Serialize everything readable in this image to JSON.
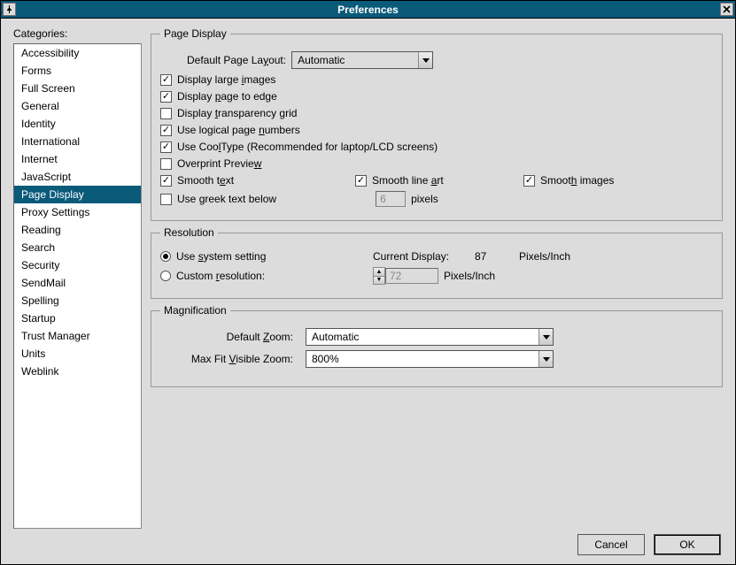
{
  "title": "Preferences",
  "categories_label": "Categories:",
  "categories": [
    "Accessibility",
    "Forms",
    "Full Screen",
    "General",
    "Identity",
    "International",
    "Internet",
    "JavaScript",
    "Page Display",
    "Proxy Settings",
    "Reading",
    "Search",
    "Security",
    "SendMail",
    "Spelling",
    "Startup",
    "Trust Manager",
    "Units",
    "Weblink"
  ],
  "selected_category_index": 8,
  "page_display": {
    "legend": "Page Display",
    "default_layout_label_pre": "Default Page La",
    "default_layout_label_u": "y",
    "default_layout_label_post": "out:",
    "default_layout_value": "Automatic",
    "cb_large_images": {
      "checked": true,
      "pre": "Display large ",
      "u": "i",
      "post": "mages"
    },
    "cb_page_edge": {
      "checked": true,
      "pre": "Display ",
      "u": "p",
      "post": "age to edge"
    },
    "cb_transparency": {
      "checked": false,
      "pre": "Display ",
      "u": "t",
      "post": "ransparency grid"
    },
    "cb_logical_nums": {
      "checked": true,
      "pre": "Use logical page ",
      "u": "n",
      "post": "umbers"
    },
    "cb_cooltype": {
      "checked": true,
      "pre": "Use Coo",
      "u": "l",
      "post": "Type (Recommended for laptop/LCD screens)"
    },
    "cb_overprint": {
      "checked": false,
      "pre": "Overprint Previe",
      "u": "w",
      "post": ""
    },
    "cb_smooth_text": {
      "checked": true,
      "pre": "Smooth t",
      "u": "e",
      "post": "xt"
    },
    "cb_smooth_line": {
      "checked": true,
      "pre": "Smooth line ",
      "u": "a",
      "post": "rt"
    },
    "cb_smooth_images": {
      "checked": true,
      "pre": "Smoot",
      "u": "h",
      "post": " images"
    },
    "cb_greek": {
      "checked": false,
      "pre": "Use ",
      "u": "g",
      "post": "reek text below"
    },
    "greek_value": "6",
    "greek_unit": "pixels"
  },
  "resolution": {
    "legend": "Resolution",
    "use_system": {
      "selected": true,
      "pre": "Use ",
      "u": "s",
      "post": "ystem setting"
    },
    "custom": {
      "selected": false,
      "pre": "Custom ",
      "u": "r",
      "post": "esolution:"
    },
    "current_display_label": "Current Display:",
    "current_display_value": "87",
    "unit": "Pixels/Inch",
    "custom_value": "72"
  },
  "magnification": {
    "legend": "Magnification",
    "default_zoom_pre": "Default ",
    "default_zoom_u": "Z",
    "default_zoom_post": "oom:",
    "default_zoom_value": "Automatic",
    "max_fit_pre": "Max Fit ",
    "max_fit_u": "V",
    "max_fit_post": "isible Zoom:",
    "max_fit_value": "800%"
  },
  "buttons": {
    "cancel": "Cancel",
    "ok": "OK"
  }
}
